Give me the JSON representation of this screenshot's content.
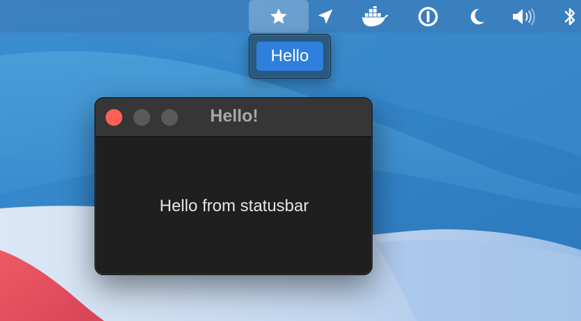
{
  "menubar": {
    "items": [
      {
        "icon": "star-icon",
        "active": true
      },
      {
        "icon": "location-arrow-icon"
      },
      {
        "icon": "docker-icon"
      },
      {
        "icon": "1password-icon"
      },
      {
        "icon": "moon-icon"
      },
      {
        "icon": "volume-icon"
      },
      {
        "icon": "bluetooth-icon"
      }
    ]
  },
  "status_menu": {
    "item_label": "Hello"
  },
  "window": {
    "title": "Hello!",
    "content_text": "Hello from statusbar"
  },
  "colors": {
    "accent": "#2f7fdc",
    "close": "#fe5f57",
    "window_bg": "#1f1f1f",
    "titlebar_bg": "#363636"
  }
}
